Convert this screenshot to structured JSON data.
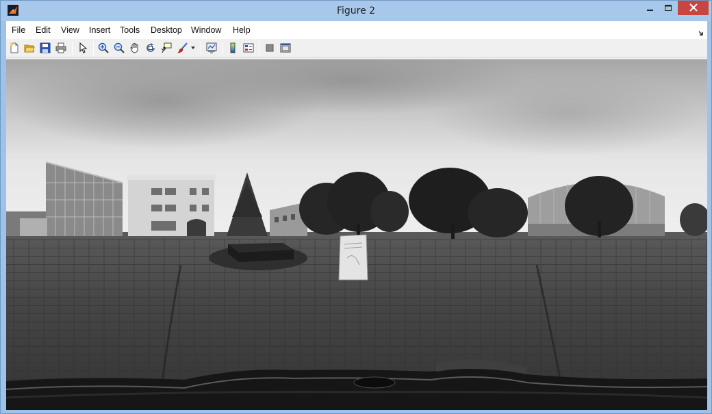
{
  "window": {
    "title": "Figure 2",
    "icon": "matlab-icon",
    "controls": {
      "minimize": "minimize-icon",
      "maximize": "maximize-icon",
      "close": "close-icon"
    }
  },
  "menu": {
    "items": [
      {
        "label": "File"
      },
      {
        "label": "Edit"
      },
      {
        "label": "View"
      },
      {
        "label": "Insert"
      },
      {
        "label": "Tools"
      },
      {
        "label": "Desktop"
      },
      {
        "label": "Window"
      },
      {
        "label": "Help"
      }
    ],
    "dock_icon": "dock-arrow-icon"
  },
  "toolbar": {
    "buttons": [
      {
        "icon": "new-figure-icon"
      },
      {
        "icon": "open-file-icon"
      },
      {
        "icon": "save-figure-icon"
      },
      {
        "icon": "print-figure-icon"
      },
      {
        "icon": "edit-plot-icon"
      },
      {
        "icon": "zoom-in-icon"
      },
      {
        "icon": "zoom-out-icon"
      },
      {
        "icon": "pan-icon"
      },
      {
        "icon": "rotate-3d-icon"
      },
      {
        "icon": "data-cursor-icon"
      },
      {
        "icon": "brush-icon"
      },
      {
        "icon": "brush-dropdown-icon"
      },
      {
        "icon": "link-plot-icon"
      },
      {
        "icon": "insert-colorbar-icon"
      },
      {
        "icon": "insert-legend-icon"
      },
      {
        "icon": "hide-plot-tools-icon"
      },
      {
        "icon": "show-plot-tools-icon"
      }
    ]
  },
  "figure": {
    "content": "grayscale 360-degree panorama image",
    "colors": {
      "sky": "#d9d9d9",
      "ground": "#3c3c3c",
      "title_bar": "#a7c8ea",
      "close_button": "#c7463f"
    }
  }
}
